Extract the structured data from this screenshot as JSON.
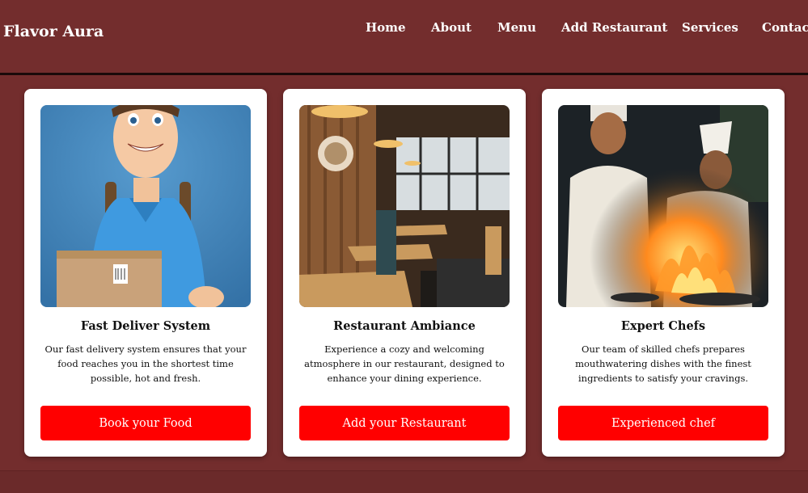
{
  "header": {
    "brand": "Flavor Aura",
    "nav": [
      {
        "label": "Home"
      },
      {
        "label": "About"
      },
      {
        "label": "Menu"
      },
      {
        "label": "Add Restaurant"
      },
      {
        "label": "Services"
      },
      {
        "label": "Contact"
      }
    ]
  },
  "cards": [
    {
      "title": "Fast Deliver System",
      "description": "Our fast delivery system ensures that your food reaches you in the shortest time possible, hot and fresh.",
      "button": "Book your Food",
      "image": "delivery-man-illustration"
    },
    {
      "title": "Restaurant Ambiance",
      "description": "Experience a cozy and welcoming atmosphere in our restaurant, designed to enhance your dining experience.",
      "button": "Add your Restaurant",
      "image": "restaurant-interior-photo"
    },
    {
      "title": "Expert Chefs",
      "description": "Our team of skilled chefs prepares mouthwatering dishes with the finest ingredients to satisfy your cravings.",
      "button": "Experienced chef",
      "image": "chefs-cooking-photo"
    }
  ],
  "colors": {
    "background": "#732d2d",
    "accent_button": "#ff0000",
    "card": "#ffffff"
  }
}
